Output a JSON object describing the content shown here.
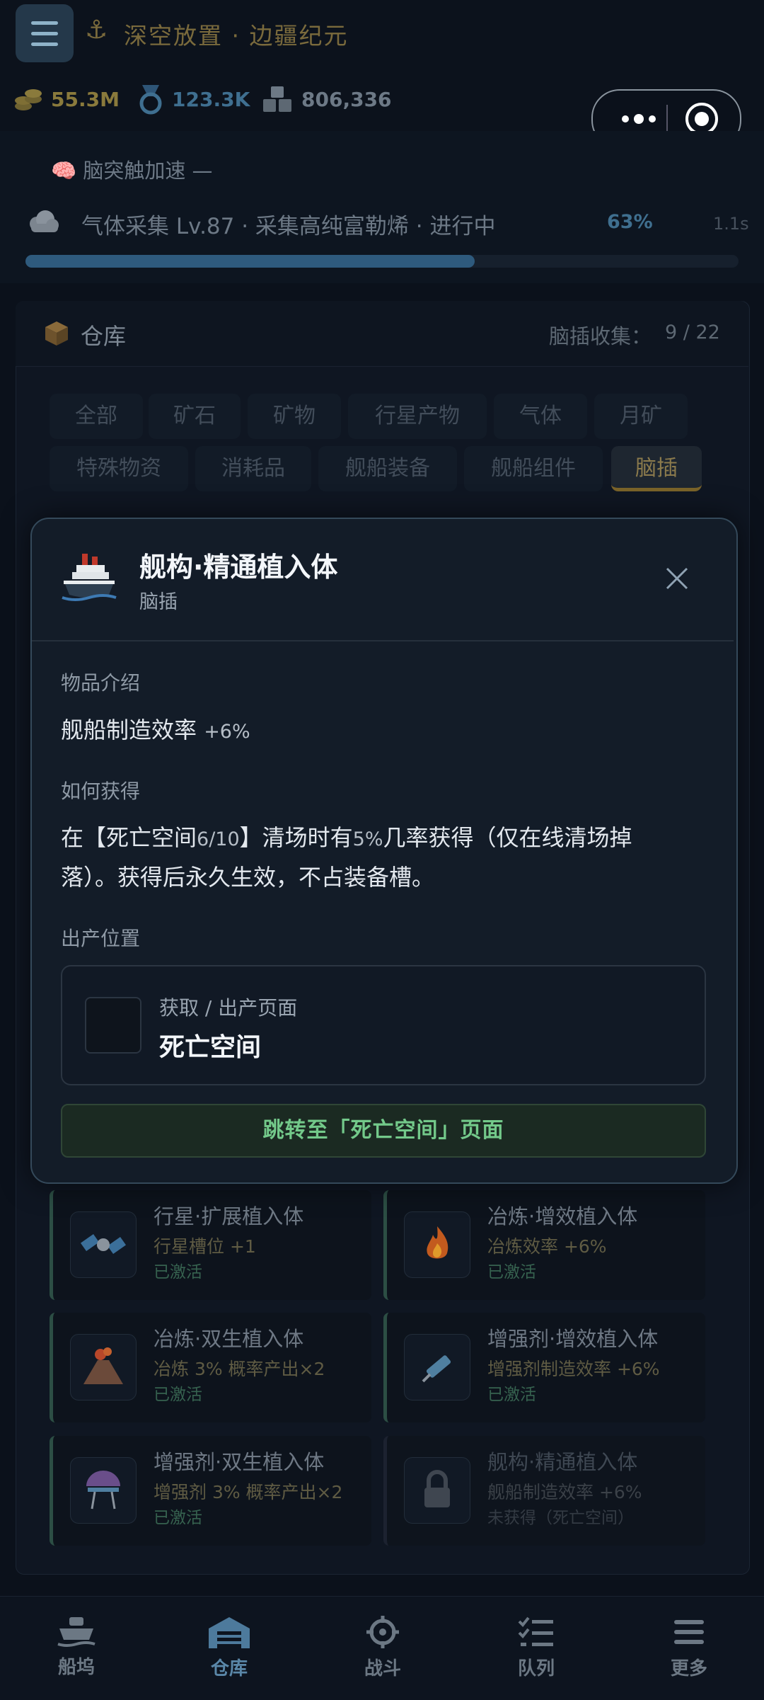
{
  "header": {
    "title": "深空放置 · 边疆纪元",
    "resources": [
      {
        "icon": "coins-icon",
        "value": "55.3M",
        "color": "#8a7a3c"
      },
      {
        "icon": "medal-icon",
        "value": "123.3K",
        "color": "#3f6f90"
      },
      {
        "icon": "blocks-icon",
        "value": "806,336",
        "color": "#6d7986"
      }
    ]
  },
  "task": {
    "boost_label": "🧠 脑突触加速 —",
    "text": "气体采集 Lv.87 · 采集高纯富勒烯 · 进行中",
    "percent": "63%",
    "progress": 0.63,
    "time": "1.1s"
  },
  "warehouse": {
    "title": "仓库",
    "collect_label": "脑插收集：",
    "collect_value": "9 / 22",
    "tabs": [
      "全部",
      "矿石",
      "矿物",
      "行星产物",
      "气体",
      "月矿",
      "特殊物资",
      "消耗品",
      "舰船装备",
      "舰船组件",
      "脑插"
    ],
    "active_tab": "脑插",
    "cards": [
      {
        "name": "行星·扩展植入体",
        "effect": "行星槽位 +1",
        "status": "已激活",
        "icon": "satellite-icon"
      },
      {
        "name": "冶炼·增效植入体",
        "effect": "冶炼效率 +6%",
        "status": "已激活",
        "icon": "fire-icon"
      },
      {
        "name": "冶炼·双生植入体",
        "effect": "冶炼 3% 概率产出×2",
        "status": "已激活",
        "icon": "volcano-icon"
      },
      {
        "name": "增强剂·增效植入体",
        "effect": "增强剂制造效率 +6%",
        "status": "已激活",
        "icon": "syringe-icon"
      },
      {
        "name": "增强剂·双生植入体",
        "effect": "增强剂 3% 概率产出×2",
        "status": "已激活",
        "icon": "grill-icon"
      },
      {
        "name": "舰构·精通植入体",
        "effect": "舰船制造效率 +6%",
        "status": "未获得（死亡空间）",
        "icon": "lock-icon"
      }
    ]
  },
  "modal": {
    "title": "舰构·精通植入体",
    "subtitle": "脑插",
    "intro_label": "物品介绍",
    "intro_main": "舰船制造效率",
    "intro_bonus": "+6%",
    "obtain_label": "如何获得",
    "obtain_line1_a": "在【死亡空间",
    "obtain_line1_b": "6/10",
    "obtain_line1_c": "】清场时有",
    "obtain_line1_d": "5%",
    "obtain_line1_e": "几率获得（仅在线清场掉",
    "obtain_line2": "落）。获得后永久生效，不占装备槽。",
    "location_label": "出产位置",
    "source_caption": "获取 / 出产页面",
    "source_name": "死亡空间",
    "jump_button": "跳转至「死亡空间」页面"
  },
  "nav": [
    {
      "label": "船坞",
      "icon": "dock-icon"
    },
    {
      "label": "仓库",
      "icon": "warehouse-icon",
      "active": true
    },
    {
      "label": "战斗",
      "icon": "crosshair-icon"
    },
    {
      "label": "队列",
      "icon": "checklist-icon"
    },
    {
      "label": "更多",
      "icon": "menu-icon"
    }
  ]
}
